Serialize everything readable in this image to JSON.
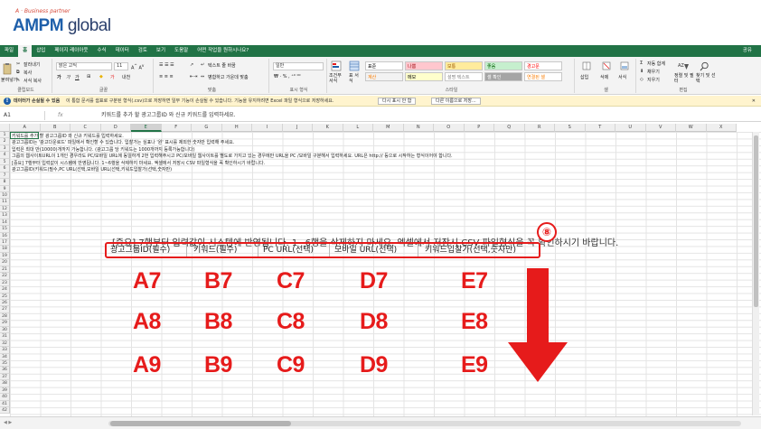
{
  "logo": {
    "tagline": "A · Business partner",
    "brand_main": "AMPM",
    "brand_rest": "global"
  },
  "tabs": [
    "파일",
    "홈",
    "삽입",
    "페이지 레이아웃",
    "수식",
    "데이터",
    "검토",
    "보기",
    "도움말",
    "어떤 작업을 원하시나요?"
  ],
  "active_tab": "홈",
  "share_label": "공유",
  "ribbon": {
    "paste": "붙여넣기",
    "cut": "잘라내기",
    "copy": "복사",
    "format_painter": "서식 복사",
    "clipboard": "클립보드",
    "font_name": "맑은 고딕",
    "font_size": "11",
    "font_group": "글꼴",
    "wrap_text": "텍스트 줄 바꿈",
    "merge_center": "병합하고 가운데 맞춤",
    "alignment_group": "맞춤",
    "number_format": "일반",
    "number_group": "표시 형식",
    "conditional": "조건부 서식",
    "table_format": "표 서식",
    "styles": [
      {
        "label": "표준",
        "bg": "#ffffff",
        "fg": "#000000"
      },
      {
        "label": "나쁨",
        "bg": "#ffc7ce",
        "fg": "#9c0006"
      },
      {
        "label": "보통",
        "bg": "#ffeb9c",
        "fg": "#9c5700"
      },
      {
        "label": "좋음",
        "bg": "#c6efce",
        "fg": "#006100"
      },
      {
        "label": "경고문",
        "bg": "#ffffff",
        "fg": "#ff0000"
      },
      {
        "label": "계산",
        "bg": "#f2f2f2",
        "fg": "#fa7d00"
      },
      {
        "label": "메모",
        "bg": "#ffffcc",
        "fg": "#000000"
      },
      {
        "label": "설명 텍스트",
        "bg": "#ffffff",
        "fg": "#7f7f7f"
      },
      {
        "label": "셀 확인",
        "bg": "#a5a5a5",
        "fg": "#ffffff"
      },
      {
        "label": "연결된 셀",
        "bg": "#ffffff",
        "fg": "#fa7d00"
      }
    ],
    "styles_group": "스타일",
    "insert": "삽입",
    "delete": "삭제",
    "format": "서식",
    "cells_group": "셀",
    "autosum": "자동 합계",
    "fill": "채우기",
    "clear": "지우기",
    "sort_filter": "정렬 및 필터",
    "find_select": "찾기 및 선택",
    "editing_group": "편집"
  },
  "message_bar": {
    "title": "데이터가 손실될 수 있음",
    "text": "이 통합 문서를 쉼표로 구분된 형식(.csv)으로 저장하면 일부 기능이 손실될 수 있습니다. 기능을 유지하려면 Excel 파일 형식으로 저장하세요.",
    "btn1": "다시 표시 안 함",
    "btn2": "다른 이름으로 저장..."
  },
  "formula_bar": {
    "name_box": "A1",
    "fx": "fx",
    "content": "키워드를 추가 할 광고그룹ID 와 신규 키워드를 입력하세요."
  },
  "columns": [
    "A",
    "B",
    "C",
    "D",
    "E",
    "F",
    "G",
    "H",
    "I",
    "J",
    "K",
    "L",
    "M",
    "N",
    "O",
    "P",
    "Q",
    "R",
    "S",
    "T",
    "U",
    "V",
    "W",
    "X"
  ],
  "selected_column": "E",
  "rows": [
    "1",
    "2",
    "3",
    "4",
    "5",
    "6",
    "7",
    "8",
    "9",
    "10",
    "11",
    "12",
    "13",
    "14",
    "15",
    "16",
    "17",
    "18",
    "19",
    "20",
    "21",
    "22",
    "23",
    "24",
    "25",
    "26",
    "27",
    "28",
    "29",
    "30",
    "31",
    "32",
    "33",
    "34",
    "35",
    "36",
    "37",
    "38",
    "39",
    "40",
    "41",
    "42"
  ],
  "sheet_lines": [
    "키워드를 추가 할 광고그룹ID 와 신규 키워드를 입력하세요.",
    "광고그룹ID는 '광고다운로드' 파일에서 확인할 수 있습니다. 입찰가는 심표나 '원' 표시를 제외한 숫자만 입력해 주세요.",
    "입력은 최대 만(10000)개까지 가능합니다. (광고그룹 당 키워드는 1000개까지 등록가능합니다)",
    "그룹의 웹사이트URL이 1개인 경우라도 PC/모바일 URL에 동일하게 2번 입력해주시고 PC/모바일 웹사이트를 별도로 가지고 있는 경우에만 URL을 PC /모바일 구분해서 입력하세요. URL은 http:// 등으로 시작하는 형식이어야 합니다.",
    "[중요] 7행부터 입력값이 시스템에 반영됩니다. 1~6행을 삭제하지 마세요. 엑셀에서 저장시 CSV 파일형식을 꼭 확인하시기 바랍니다.",
    "광고그룹ID(키워드(필수,PC URL(선택,모바일 URL(선택,키워드입찰가(선택,숫자만)"
  ],
  "big_instruction": "[중요] 7행부터 입력값이 시스템에 반영됩니다. 1~6행을 삭제하지 마세요. 엑셀에서 저장시 CSV 파일형식을 꼭 확인하시기 바랍니다.",
  "header_cells": [
    "광고그룹ID(필수)",
    "키워드(필수)",
    "PC URL(선택)",
    "모바일 URL(선택)",
    "키워드입찰가(선택,숫자만)"
  ],
  "step_badge": "⑧",
  "cell_labels": [
    [
      "A7",
      "B7",
      "C7",
      "D7",
      "E7"
    ],
    [
      "A8",
      "B8",
      "C8",
      "D8",
      "E8"
    ],
    [
      "A9",
      "B9",
      "C9",
      "D9",
      "E9"
    ]
  ],
  "accent_red": "#e61b1b",
  "excel_green": "#217346"
}
